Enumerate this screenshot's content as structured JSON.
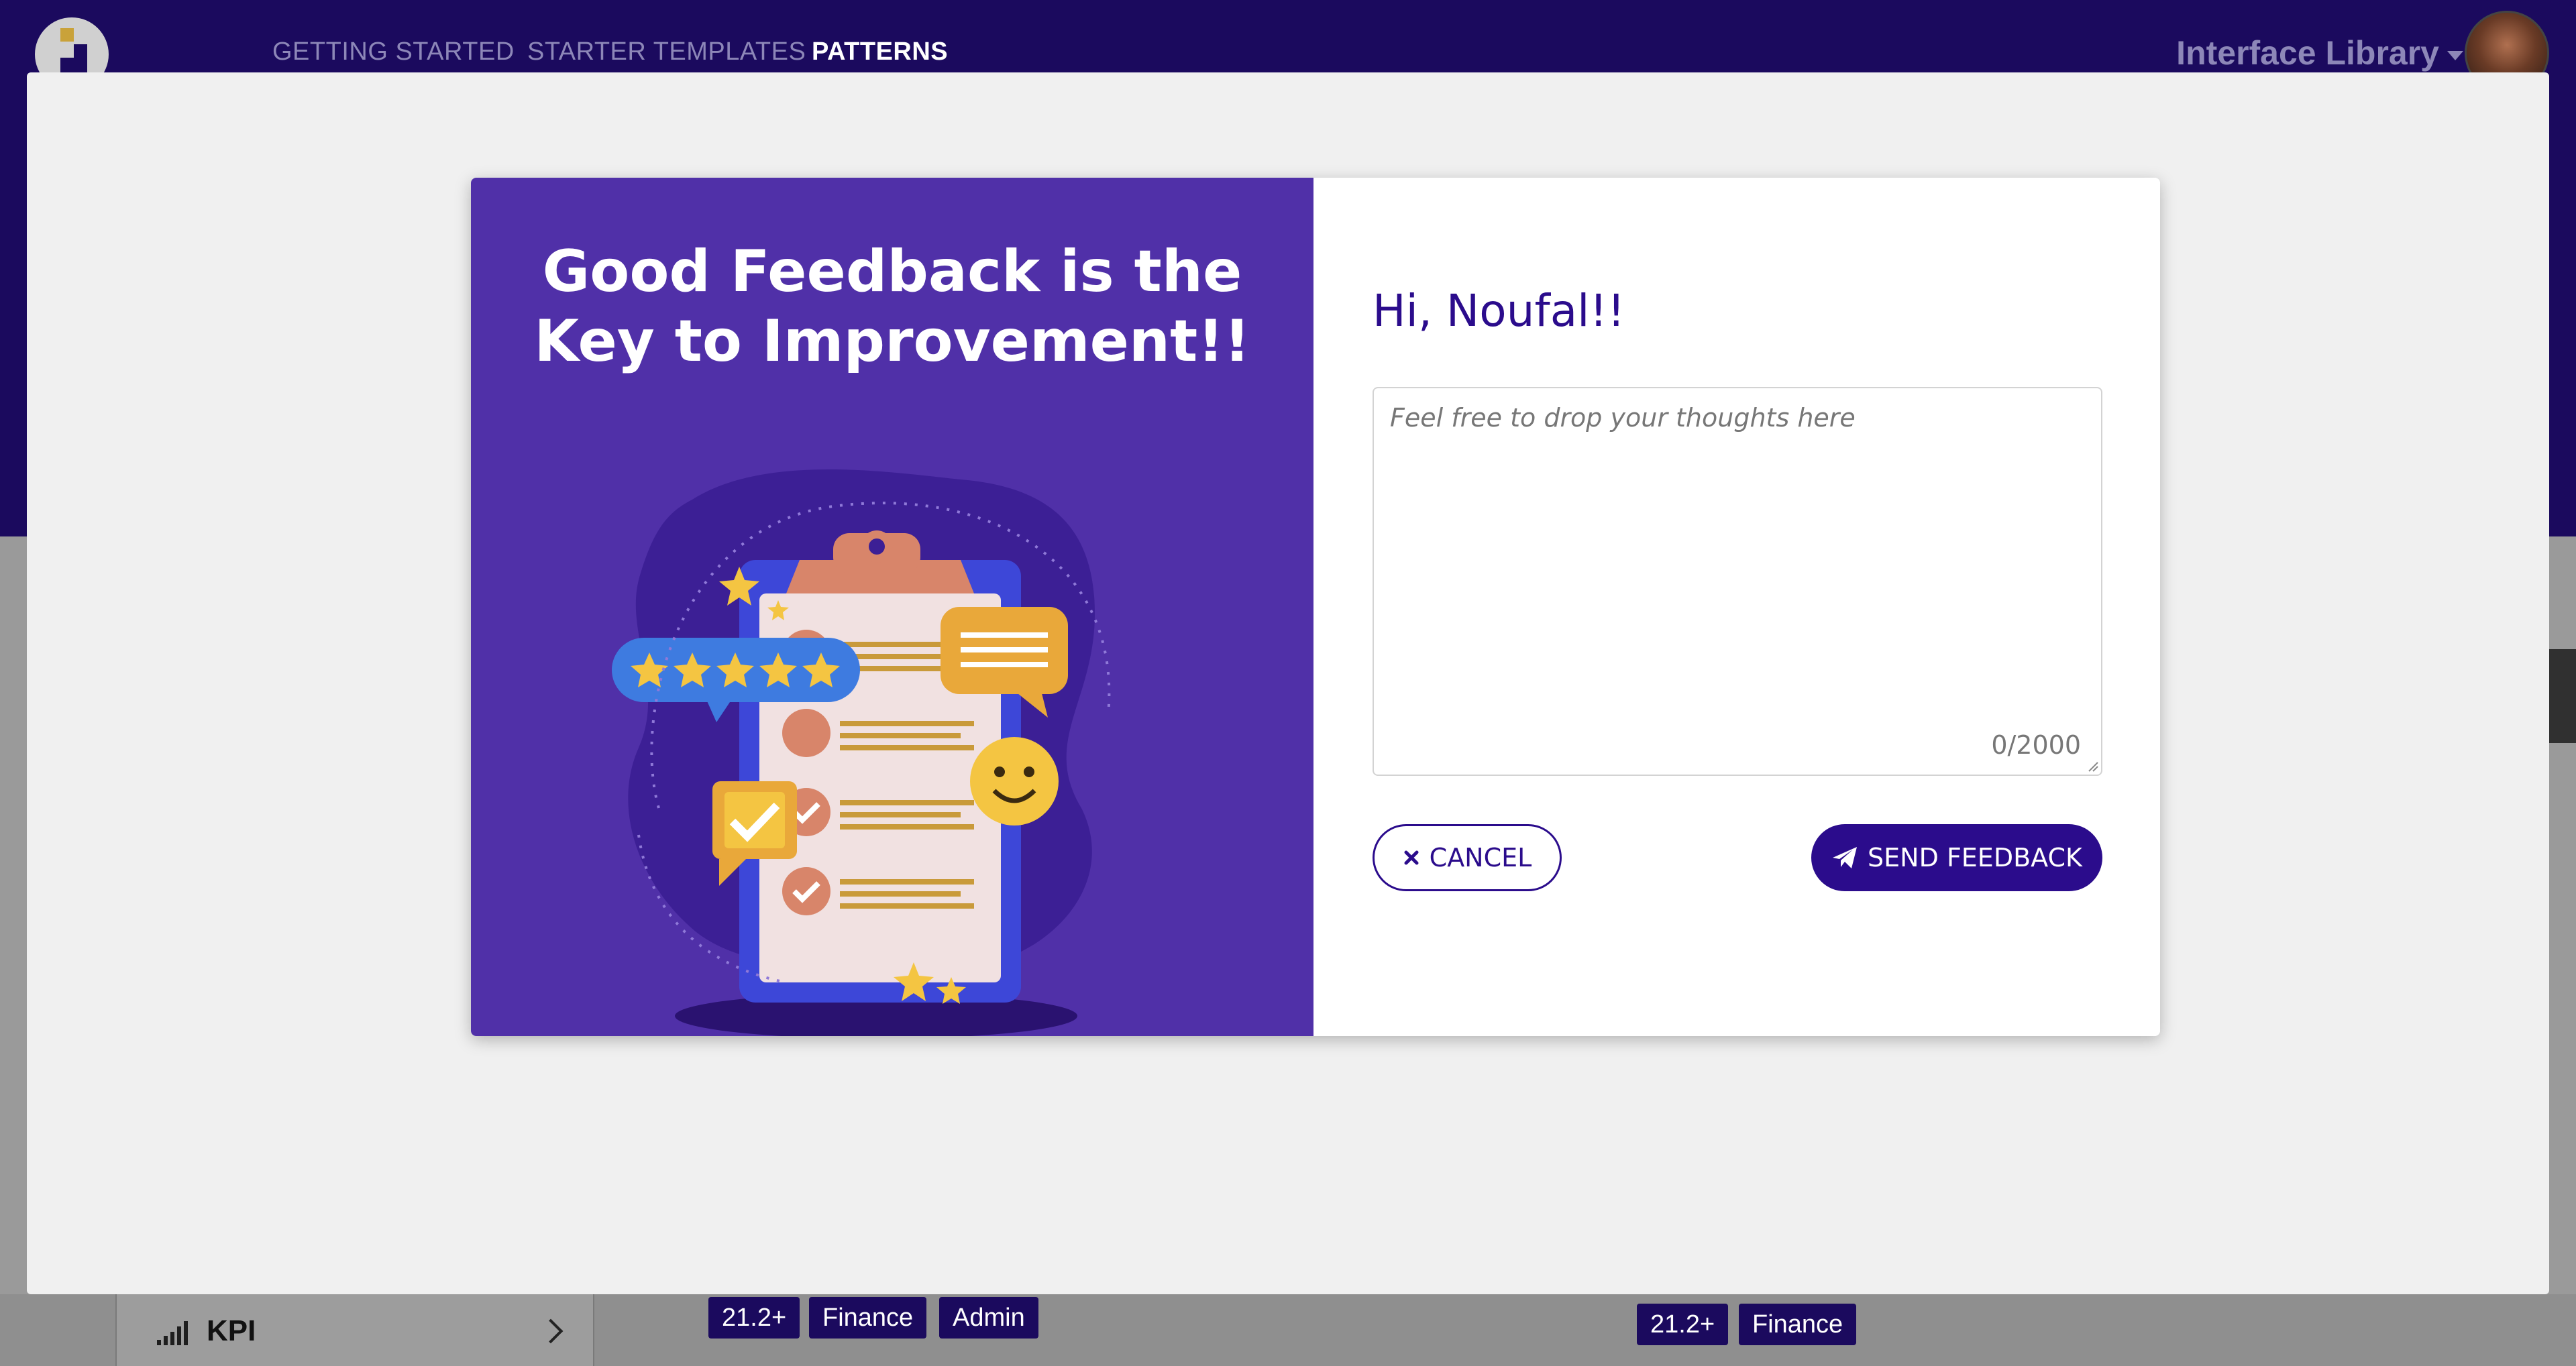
{
  "header": {
    "nav": [
      "GETTING STARTED",
      "STARTER TEMPLATES",
      "PATTERNS"
    ],
    "active_nav": "PATTERNS",
    "library_title": "Interface Library"
  },
  "background": {
    "kpi_label": "KPI",
    "tags_left": [
      "21.2+",
      "Finance",
      "Admin"
    ],
    "tags_right": [
      "21.2+",
      "Finance"
    ]
  },
  "modal": {
    "title": "Good Feedback is the Key to Improvement!!",
    "greeting": "Hi, Noufal!!",
    "feedback": {
      "placeholder": "Feel free to drop your thoughts here",
      "value": "",
      "counter": "0/2000"
    },
    "cancel_label": "CANCEL",
    "send_label": "SEND FEEDBACK"
  },
  "colors": {
    "brand_dark": "#1b0a5e",
    "accent": "#2b0c8c",
    "panel_purple": "#5030a8"
  }
}
